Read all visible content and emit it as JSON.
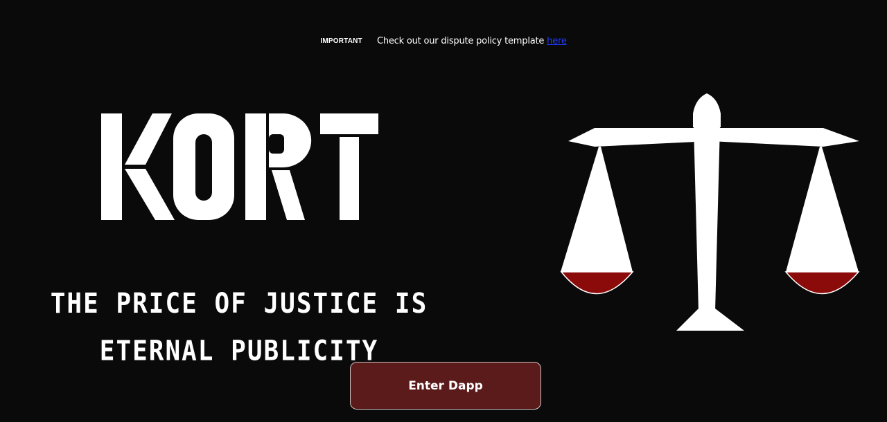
{
  "announcement": {
    "badge": "IMPORTANT",
    "text": "Check out our dispute policy template ",
    "link_label": "here",
    "link_color": "#1f3cff"
  },
  "brand": {
    "logo_text": "KORT"
  },
  "hero": {
    "tagline": "THE PRICE OF JUSTICE IS ETERNAL PUBLICITY"
  },
  "cta": {
    "enter_label": "Enter Dapp"
  },
  "icons": {
    "scales": "scales-of-justice-icon"
  },
  "colors": {
    "background": "#0b0a0a",
    "text": "#ffffff",
    "button_fill": "#5b1b1b",
    "pan_fill": "#8b0a0a"
  }
}
